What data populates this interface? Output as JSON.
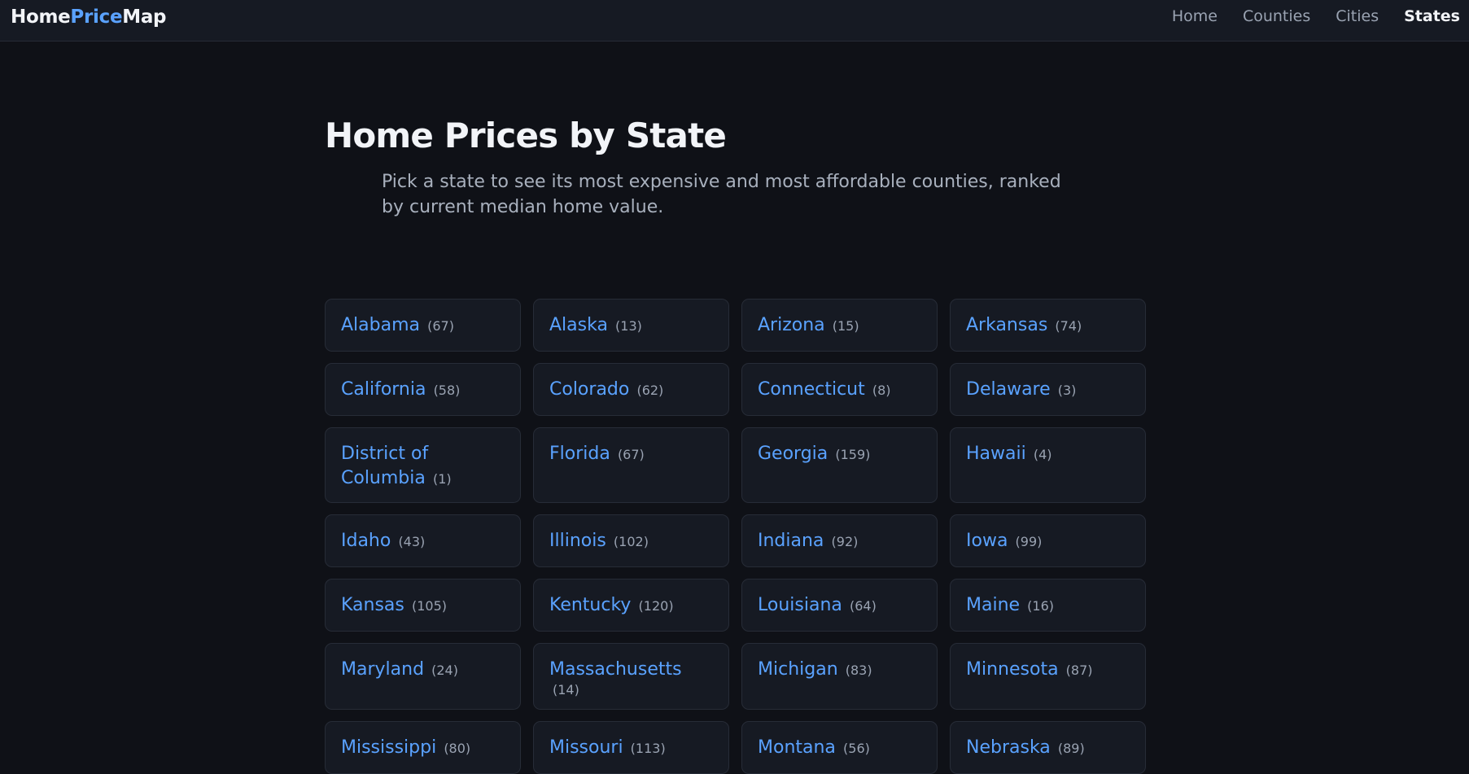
{
  "header": {
    "logo_part1": "Home",
    "logo_part2": "Price",
    "logo_part3": "Map",
    "nav": [
      {
        "label": "Home"
      },
      {
        "label": "Counties"
      },
      {
        "label": "Cities"
      },
      {
        "label": "States",
        "active": true
      }
    ]
  },
  "main": {
    "title": "Home Prices by State",
    "subtitle": "Pick a state to see its most expensive and most affordable counties, ranked by current median home value."
  },
  "states": [
    {
      "name": "Alabama",
      "count": "(67)"
    },
    {
      "name": "Alaska",
      "count": "(13)"
    },
    {
      "name": "Arizona",
      "count": "(15)"
    },
    {
      "name": "Arkansas",
      "count": "(74)"
    },
    {
      "name": "California",
      "count": "(58)"
    },
    {
      "name": "Colorado",
      "count": "(62)"
    },
    {
      "name": "Connecticut",
      "count": "(8)"
    },
    {
      "name": "Delaware",
      "count": "(3)"
    },
    {
      "name": "District of Columbia",
      "count": "(1)"
    },
    {
      "name": "Florida",
      "count": "(67)"
    },
    {
      "name": "Georgia",
      "count": "(159)"
    },
    {
      "name": "Hawaii",
      "count": "(4)"
    },
    {
      "name": "Idaho",
      "count": "(43)"
    },
    {
      "name": "Illinois",
      "count": "(102)"
    },
    {
      "name": "Indiana",
      "count": "(92)"
    },
    {
      "name": "Iowa",
      "count": "(99)"
    },
    {
      "name": "Kansas",
      "count": "(105)"
    },
    {
      "name": "Kentucky",
      "count": "(120)"
    },
    {
      "name": "Louisiana",
      "count": "(64)"
    },
    {
      "name": "Maine",
      "count": "(16)"
    },
    {
      "name": "Maryland",
      "count": "(24)"
    },
    {
      "name": "Massachusetts",
      "count": "(14)"
    },
    {
      "name": "Michigan",
      "count": "(83)"
    },
    {
      "name": "Minnesota",
      "count": "(87)"
    },
    {
      "name": "Mississippi",
      "count": "(80)"
    },
    {
      "name": "Missouri",
      "count": "(113)"
    },
    {
      "name": "Montana",
      "count": "(56)"
    },
    {
      "name": "Nebraska",
      "count": "(89)"
    }
  ],
  "colors": {
    "background": "#0f1117",
    "card": "#161a23",
    "accent": "#5aa2ff"
  }
}
